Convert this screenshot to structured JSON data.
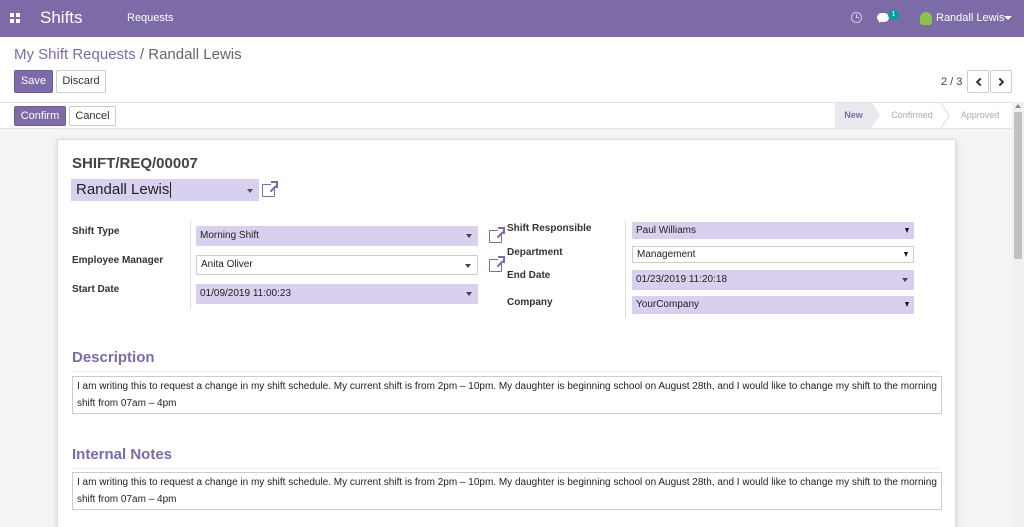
{
  "navbar": {
    "brand": "Shifts",
    "menu_requests": "Requests",
    "chat_count": "1",
    "user_name": "Randall Lewis"
  },
  "breadcrumb": {
    "parent": "My Shift Requests",
    "separator": "/",
    "current": "Randall Lewis"
  },
  "toolbar": {
    "save_label": "Save",
    "discard_label": "Discard"
  },
  "pager": {
    "value": "2 / 3"
  },
  "statusbar": {
    "confirm_label": "Confirm",
    "cancel_label": "Cancel",
    "stages": [
      "New",
      "Confirmed",
      "Approved"
    ],
    "active_stage": "New"
  },
  "form": {
    "reference": "SHIFT/REQ/00007",
    "employee": "Randall Lewis",
    "left_fields": [
      {
        "label": "Shift Type",
        "value": "Morning Shift"
      },
      {
        "label": "Employee Manager",
        "value": "Anita Oliver"
      },
      {
        "label": "Start Date",
        "value": "01/09/2019 11:00:23"
      }
    ],
    "right_fields": [
      {
        "label": "Shift Responsible",
        "value": "Paul Williams"
      },
      {
        "label": "Department",
        "value": "Management"
      },
      {
        "label": "End Date",
        "value": "01/23/2019 11:20:18"
      },
      {
        "label": "Company",
        "value": "YourCompany"
      }
    ],
    "description_title": "Description",
    "description_text": "I am writing this to request a change in my shift schedule. My current shift is from 2pm – 10pm. My daughter is beginning school on August 28th, and I would like to change my shift to the morning shift from 07am – 4pm",
    "notes_title": "Internal Notes",
    "notes_text": "I am writing this to request a change in my shift schedule. My current shift is from 2pm – 10pm. My daughter is beginning school on August 28th, and I would like to change my shift to the morning shift from 07am – 4pm"
  },
  "colors": {
    "brand": "#7c6ba6",
    "required_field": "#d8d0ee"
  }
}
